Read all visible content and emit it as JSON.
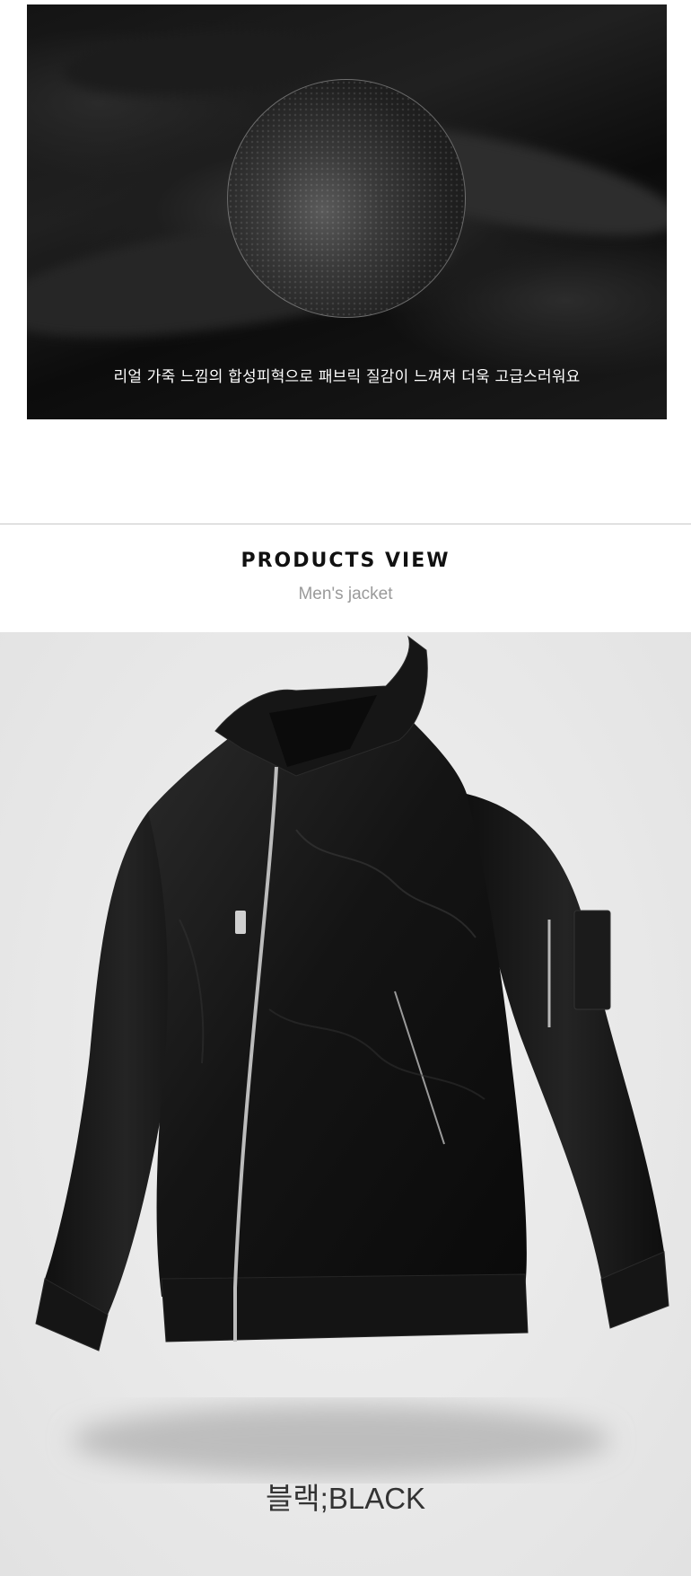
{
  "hero": {
    "caption": "리얼 가죽 느낌의 합성피혁으로 패브릭 질감이 느껴져 더욱 고급스러워요"
  },
  "products_view": {
    "title": "PRODUCTS VIEW",
    "subtitle": "Men's jacket"
  },
  "product": {
    "color_label": "블랙;BLACK",
    "colors": {
      "jacket": "#111111",
      "background": "#e9e9e9"
    }
  }
}
